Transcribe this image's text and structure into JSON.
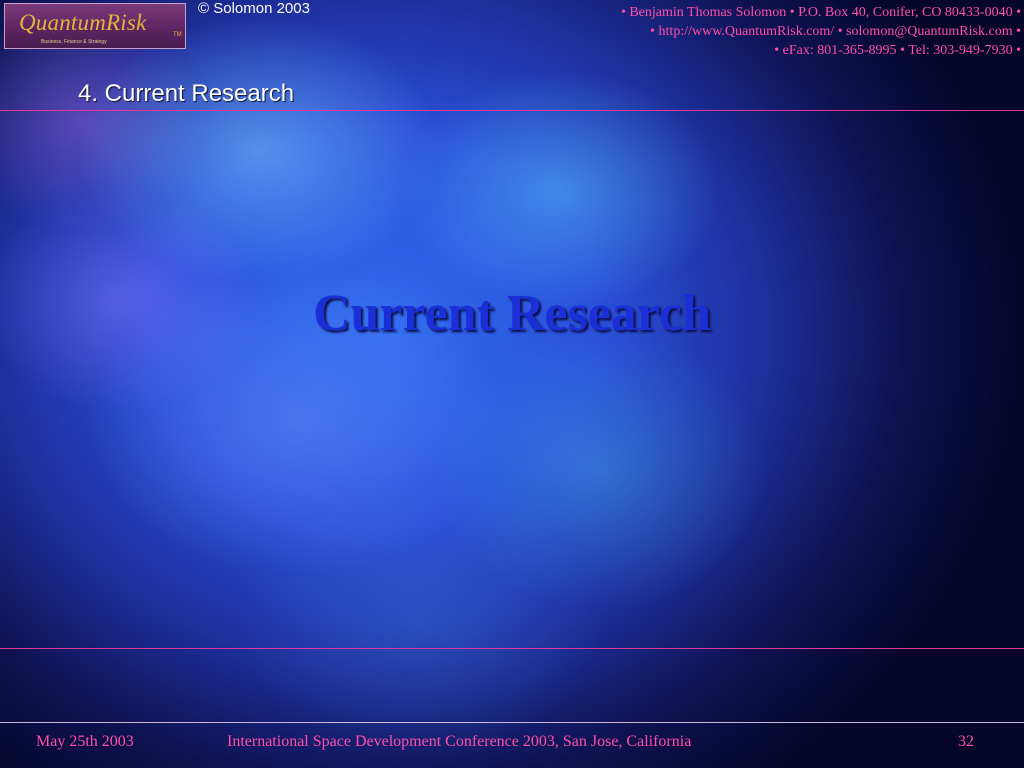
{
  "logo": {
    "name": "QuantumRisk",
    "tm": "TM",
    "tagline": "Business, Finance & Strategy"
  },
  "header": {
    "copyright": "© Solomon 2003",
    "contact_lines": [
      "• Benjamin Thomas Solomon • P.O. Box 40, Conifer, CO 80433-0040 •",
      "• http://www.QuantumRisk.com/ • solomon@QuantumRisk.com •",
      "• eFax: 801-365-8995 • Tel: 303-949-7930 •"
    ]
  },
  "section_title": "4. Current Research",
  "main_title": "Current Research",
  "footer": {
    "date": "May 25th 2003",
    "conference": "International Space Development Conference 2003, San Jose, California",
    "page_number": "32"
  },
  "colors": {
    "accent_pink": "#ff4fa8",
    "rule": "#e0359a",
    "title_blue": "#1a2fd6",
    "logo_gold": "#e5b53a"
  }
}
